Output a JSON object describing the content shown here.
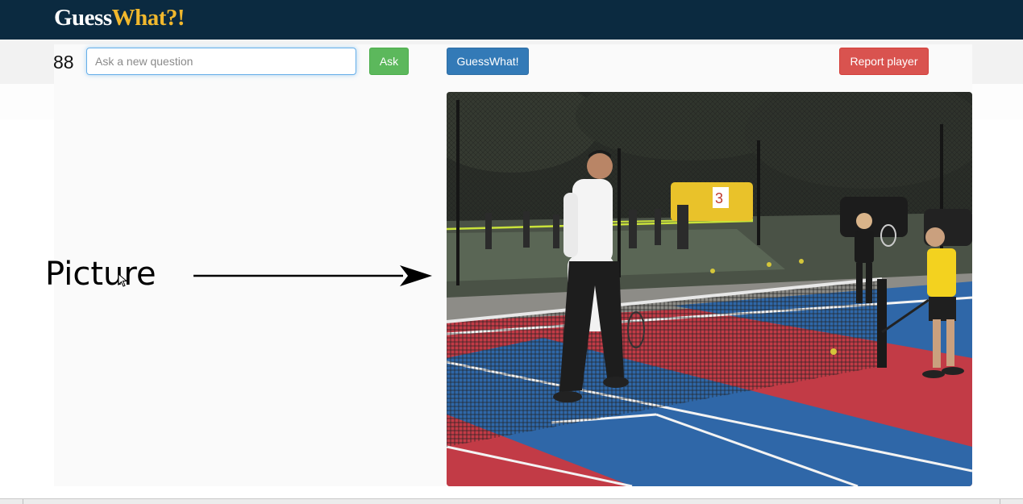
{
  "brand": {
    "part1": "Guess",
    "part2": "What?!"
  },
  "toolbar": {
    "question_count": "88",
    "question_placeholder": "Ask a new question",
    "question_value": "",
    "ask_label": "Ask",
    "guess_label": "GuessWhat!",
    "report_label": "Report player"
  },
  "annotation": {
    "label": "Picture"
  },
  "colors": {
    "navbar": "#0b2a40",
    "brand_accent": "#f1b82d",
    "ask_button": "#5cb85c",
    "guess_button": "#337ab7",
    "report_button": "#d9534f"
  },
  "image": {
    "description_icon": "tennis-court-photo"
  }
}
